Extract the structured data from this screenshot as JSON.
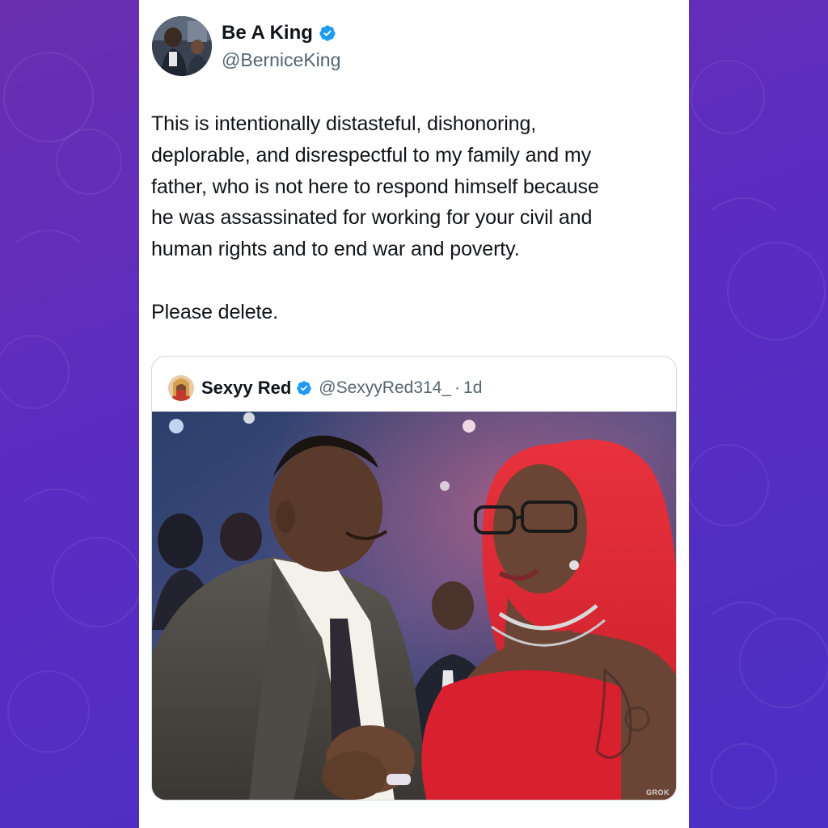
{
  "tweet": {
    "display_name": "Be A King",
    "handle": "@BerniceKing",
    "verified_icon": "verified-badge-icon",
    "text": "This is intentionally distasteful, dishonoring,\ndeplorable, and disrespectful to my family and my\nfather, who is not here to respond himself because\nhe was assassinated for working for your civil and\nhuman rights and to end war and poverty.\n\nPlease delete."
  },
  "quoted_tweet": {
    "display_name": "Sexyy Red",
    "handle": "@SexyyRed314_",
    "separator": "·",
    "time": "1d",
    "media_watermark": "GROK"
  },
  "colors": {
    "background": "#5b2cc2",
    "card": "#ffffff",
    "verified": "#1d9bf0",
    "text_primary": "#0f1419",
    "text_secondary": "#536471"
  }
}
